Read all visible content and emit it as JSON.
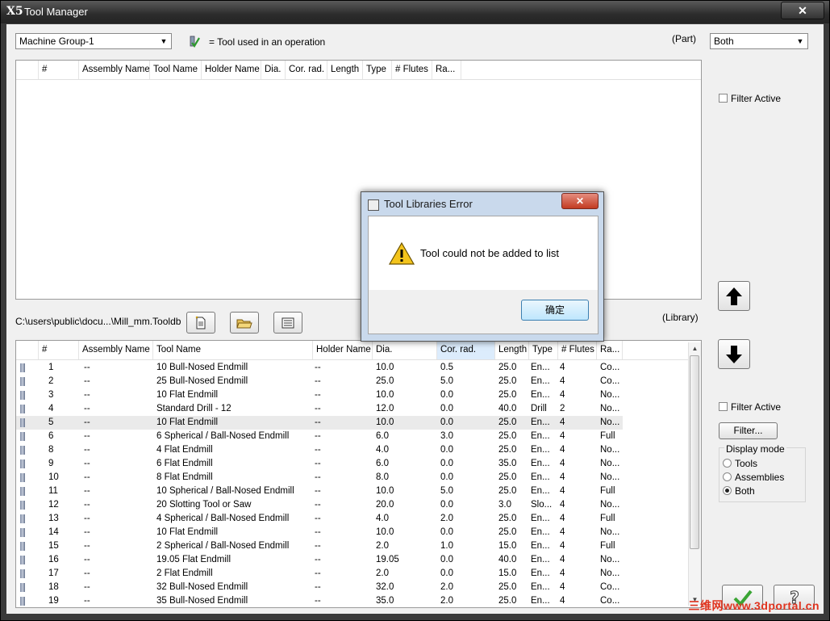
{
  "window": {
    "title": "Tool Manager",
    "logo": "X5",
    "close": "✕"
  },
  "top": {
    "machine_group": "Machine Group-1",
    "legend_icon": "tool-used-icon",
    "legend_text": "= Tool used in an operation",
    "part_label": "(Part)",
    "part_filter": "Both",
    "filter_active_label": "Filter Active"
  },
  "part_list": {
    "columns": [
      "#",
      "Assembly Name",
      "Tool Name",
      "Holder Name",
      "Dia.",
      "Cor. rad.",
      "Length",
      "Type",
      "# Flutes",
      "Ra..."
    ]
  },
  "library": {
    "path": "C:\\users\\public\\docu...\\Mill_mm.Tooldb",
    "label": "(Library)",
    "columns": [
      "#",
      "Assembly Name",
      "Tool Name",
      "Holder Name",
      "Dia.",
      "Cor. rad.",
      "Length",
      "Type",
      "# Flutes",
      "Ra..."
    ],
    "rows": [
      [
        "1",
        "--",
        "10 Bull-Nosed Endmill",
        "--",
        "10.0",
        "0.5",
        "25.0",
        "En...",
        "4",
        "Co..."
      ],
      [
        "2",
        "--",
        "25 Bull-Nosed Endmill",
        "--",
        "25.0",
        "5.0",
        "25.0",
        "En...",
        "4",
        "Co..."
      ],
      [
        "3",
        "--",
        "10 Flat Endmill",
        "--",
        "10.0",
        "0.0",
        "25.0",
        "En...",
        "4",
        "No..."
      ],
      [
        "4",
        "--",
        " Standard Drill - 12",
        "--",
        "12.0",
        "0.0",
        "40.0",
        "Drill",
        "2",
        "No..."
      ],
      [
        "5",
        "--",
        "10 Flat Endmill",
        "--",
        "10.0",
        "0.0",
        "25.0",
        "En...",
        "4",
        "No..."
      ],
      [
        "6",
        "--",
        "6 Spherical / Ball-Nosed Endmill",
        "--",
        "6.0",
        "3.0",
        "25.0",
        "En...",
        "4",
        "Full"
      ],
      [
        "8",
        "--",
        "4 Flat Endmill",
        "--",
        "4.0",
        "0.0",
        "25.0",
        "En...",
        "4",
        "No..."
      ],
      [
        "9",
        "--",
        "6 Flat Endmill",
        "--",
        "6.0",
        "0.0",
        "35.0",
        "En...",
        "4",
        "No..."
      ],
      [
        "10",
        "--",
        "8 Flat Endmill",
        "--",
        "8.0",
        "0.0",
        "25.0",
        "En...",
        "4",
        "No..."
      ],
      [
        "11",
        "--",
        "10 Spherical / Ball-Nosed Endmill",
        "--",
        "10.0",
        "5.0",
        "25.0",
        "En...",
        "4",
        "Full"
      ],
      [
        "12",
        "--",
        "20 Slotting Tool or Saw",
        "--",
        "20.0",
        "0.0",
        "3.0",
        "Slo...",
        "4",
        "No..."
      ],
      [
        "13",
        "--",
        "4 Spherical / Ball-Nosed Endmill",
        "--",
        "4.0",
        "2.0",
        "25.0",
        "En...",
        "4",
        "Full"
      ],
      [
        "14",
        "--",
        "10 Flat Endmill",
        "--",
        "10.0",
        "0.0",
        "25.0",
        "En...",
        "4",
        "No..."
      ],
      [
        "15",
        "--",
        "2 Spherical / Ball-Nosed Endmill",
        "--",
        "2.0",
        "1.0",
        "15.0",
        "En...",
        "4",
        "Full"
      ],
      [
        "16",
        "--",
        "19.05 Flat Endmill",
        "--",
        "19.05",
        "0.0",
        "40.0",
        "En...",
        "4",
        "No..."
      ],
      [
        "17",
        "--",
        "2 Flat Endmill",
        "--",
        "2.0",
        "0.0",
        "15.0",
        "En...",
        "4",
        "No..."
      ],
      [
        "18",
        "--",
        "32 Bull-Nosed Endmill",
        "--",
        "32.0",
        "2.0",
        "25.0",
        "En...",
        "4",
        "Co..."
      ],
      [
        "19",
        "--",
        "35 Bull-Nosed Endmill",
        "--",
        "35.0",
        "2.0",
        "25.0",
        "En...",
        "4",
        "Co..."
      ]
    ],
    "selected_row": 4,
    "sorted_column": "Cor. rad."
  },
  "right_panel": {
    "filter_active_label": "Filter Active",
    "filter_button": "Filter...",
    "display_mode_label": "Display mode",
    "display_modes": [
      "Tools",
      "Assemblies",
      "Both"
    ],
    "display_mode_selected": "Both"
  },
  "dialog": {
    "title": "Tool Libraries Error",
    "message": "Tool could not be added to list",
    "ok_label": "确定",
    "close": "✕"
  },
  "watermark": "三维网www.3dportal.cn",
  "colors": {
    "sorted_header": "#dcecfc",
    "selected_row": "#eaeaea",
    "ok_green": "#3aa534",
    "dialog_frame": "#c9d9ec"
  }
}
